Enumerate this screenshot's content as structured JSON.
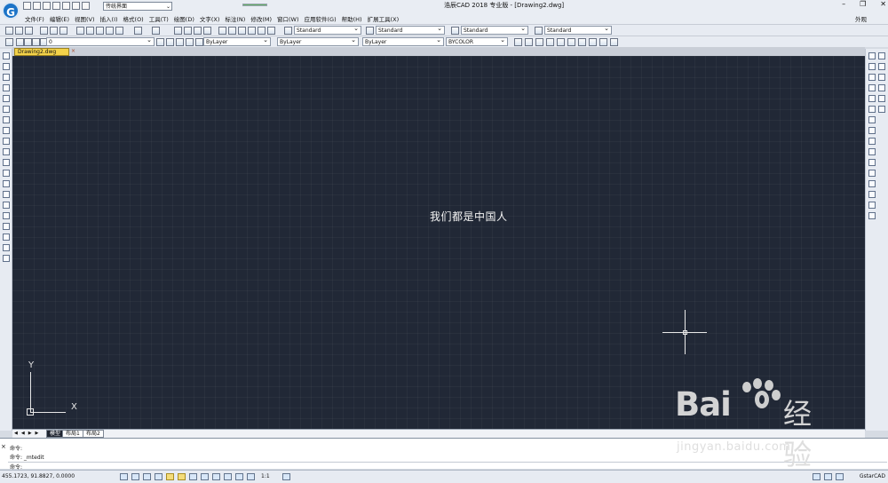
{
  "app": {
    "title": "浩辰CAD 2018 专业版 - [Drawing2.dwg]",
    "logo_letter": "G",
    "workspace": "传统界面"
  },
  "menus": [
    "文件(F)",
    "编辑(E)",
    "视图(V)",
    "插入(I)",
    "格式(O)",
    "工具(T)",
    "绘图(D)",
    "文字(X)",
    "标注(N)",
    "修改(M)",
    "窗口(W)",
    "应用软件(G)",
    "帮助(H)",
    "扩展工具(X)"
  ],
  "top_right": {
    "layout": "外观",
    "minimize": "–",
    "maximize": "❐",
    "close": "✕"
  },
  "toolbar": {
    "styles": [
      "Standard",
      "Standard",
      "Standard",
      "Standard"
    ],
    "layer": "0",
    "color": "ByLayer",
    "linetype": "ByLayer",
    "lineweight": "ByLayer",
    "plotstyle": "BYCOLOR"
  },
  "drawing_tab": {
    "name": "Drawing2.dwg",
    "close": "×"
  },
  "canvas": {
    "text": "我们都是中国人",
    "ucs_x": "X",
    "ucs_y": "Y"
  },
  "layout_tabs": {
    "model": "模型",
    "layout1": "布局1",
    "layout2": "布局2"
  },
  "command": {
    "line1": "命令:",
    "line2": "命令: _mtedit",
    "line3": "命令:"
  },
  "status": {
    "coordinates": "455.1723, 91.8827, 0.0000",
    "scale": "1:1",
    "brand": "GstarCAD"
  },
  "watermark": {
    "main": "Bai",
    "suffix": "经验",
    "url": "jingyan.baidu.com"
  }
}
